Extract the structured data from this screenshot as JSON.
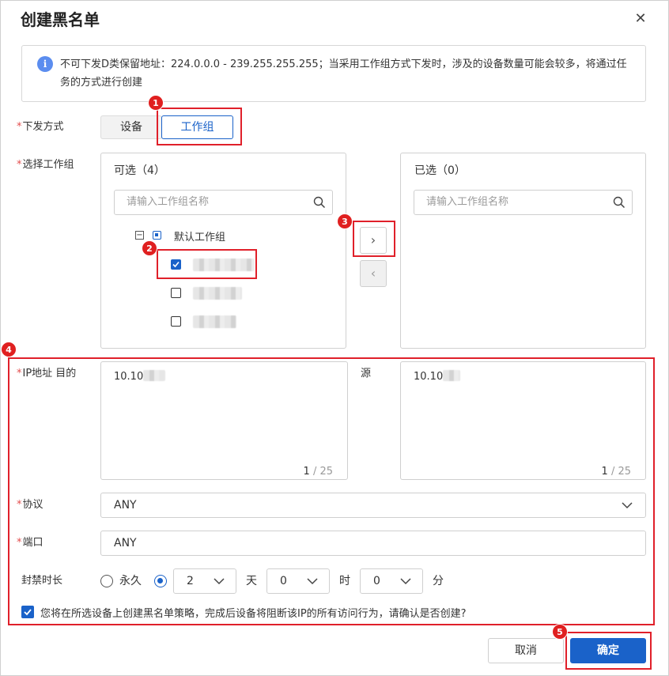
{
  "dialog": {
    "title": "创建黑名单",
    "close_glyph": "✕"
  },
  "info": {
    "icon_glyph": "i",
    "text": "不可下发D类保留地址：224.0.0.0 - 239.255.255.255；当采用工作组方式下发时，涉及的设备数量可能会较多，将通过任务的方式进行创建"
  },
  "dispatch": {
    "label": "下发方式",
    "required_mark": "*",
    "options": [
      "设备",
      "工作组"
    ],
    "selected": "工作组"
  },
  "workgroup": {
    "label": "选择工作组",
    "required_mark": "*",
    "available": {
      "title": "可选（4）",
      "search_placeholder": "请输入工作组名称",
      "group_name": "默认工作组",
      "group_expand_glyph": "−",
      "items": [
        {
          "checked": true
        },
        {
          "checked": false
        },
        {
          "checked": false
        }
      ]
    },
    "selected": {
      "title": "已选（0）",
      "search_placeholder": "请输入工作组名称"
    },
    "move_right_glyph": "›",
    "move_left_glyph": "‹"
  },
  "ip": {
    "label": "IP地址 目的",
    "required_mark": "*",
    "dest_value": "10.10",
    "dest_count": "1",
    "dest_max": " / 25",
    "source_label": "源",
    "source_value": "10.10",
    "source_count": "1",
    "source_max": " / 25"
  },
  "protocol": {
    "label": "协议",
    "required_mark": "*",
    "value": "ANY"
  },
  "port": {
    "label": "端口",
    "required_mark": "*",
    "value": "ANY"
  },
  "duration": {
    "label": "封禁时长",
    "permanent_label": "永久",
    "days_value": "2",
    "days_unit": "天",
    "hours_value": "0",
    "hours_unit": "时",
    "minutes_value": "0",
    "minutes_unit": "分"
  },
  "confirm": {
    "text": "您将在所选设备上创建黑名单策略，完成后设备将阻断该IP的所有访问行为，请确认是否创建?"
  },
  "footer": {
    "cancel_label": "取消",
    "ok_label": "确定"
  },
  "badges": [
    "1",
    "2",
    "3",
    "4",
    "5"
  ],
  "colors": {
    "primary": "#1a62c9",
    "highlight": "#e0202a",
    "info_icon": "#5b8def"
  }
}
